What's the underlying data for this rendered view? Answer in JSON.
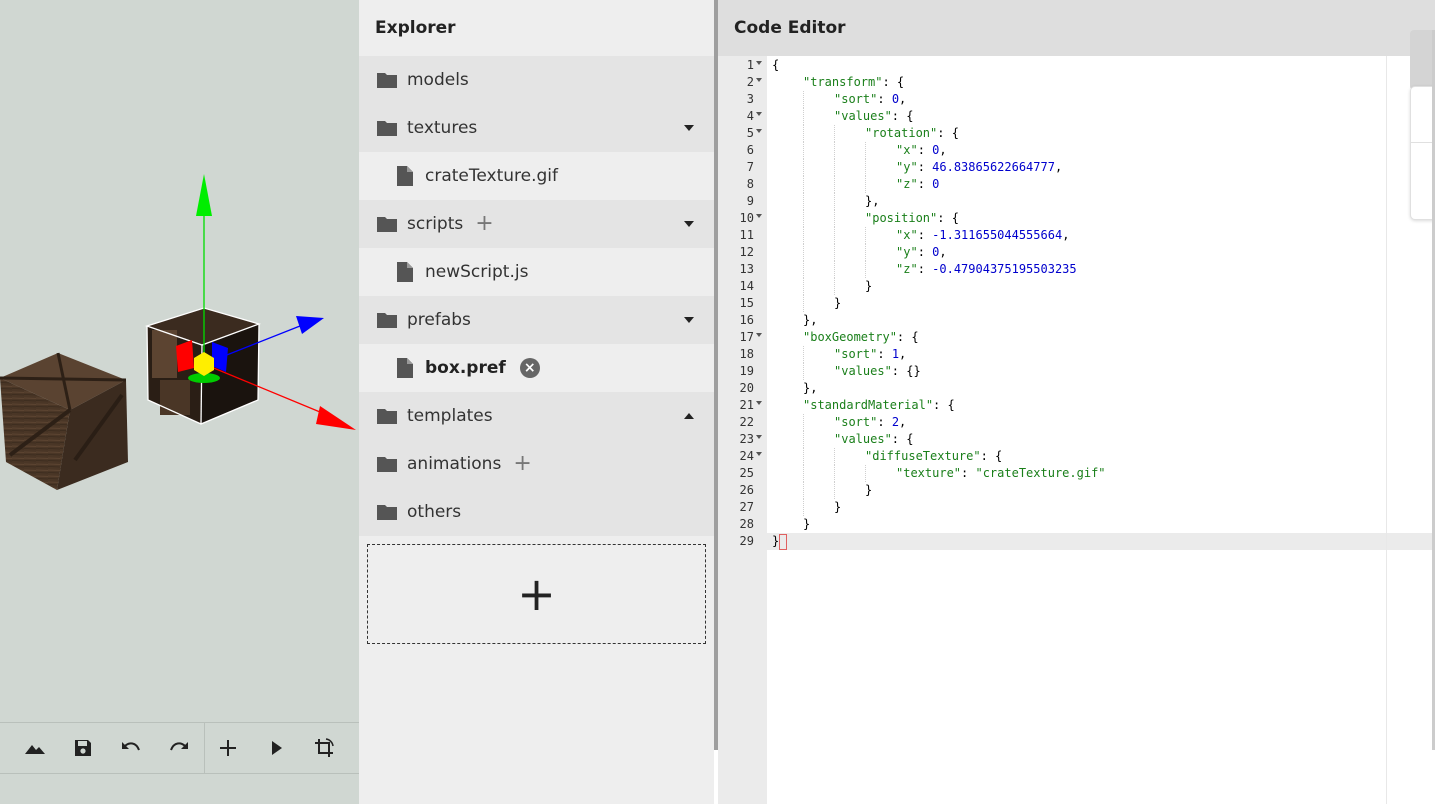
{
  "viewport": {
    "toolbar": {
      "terrain_icon": "terrain-icon",
      "save_icon": "save-icon",
      "undo_icon": "undo-icon",
      "redo_icon": "redo-icon",
      "add_icon": "add-icon",
      "play_icon": "play-icon",
      "transform_icon": "transform-icon"
    },
    "gizmo_colors": {
      "x": "#ff0000",
      "y": "#00cc00",
      "z": "#0000ff",
      "center": "#ffee00"
    }
  },
  "explorer": {
    "title": "Explorer",
    "items": [
      {
        "type": "folder",
        "label": "models",
        "plus": false,
        "caret": ""
      },
      {
        "type": "folder",
        "label": "textures",
        "plus": false,
        "caret": "down"
      },
      {
        "type": "file",
        "label": "crateTexture.gif",
        "bold": false,
        "close": false
      },
      {
        "type": "folder",
        "label": "scripts",
        "plus": true,
        "caret": "down"
      },
      {
        "type": "file",
        "label": "newScript.js",
        "bold": false,
        "close": false
      },
      {
        "type": "folder",
        "label": "prefabs",
        "plus": false,
        "caret": "down"
      },
      {
        "type": "file",
        "label": "box.pref",
        "bold": true,
        "close": true
      },
      {
        "type": "folder",
        "label": "templates",
        "plus": false,
        "caret": "up"
      },
      {
        "type": "folder",
        "label": "animations",
        "plus": true,
        "caret": ""
      },
      {
        "type": "folder",
        "label": "others",
        "plus": false,
        "caret": ""
      }
    ],
    "drop_zone_label": "+"
  },
  "editor": {
    "title": "Code Editor",
    "active_line": 29,
    "lines": [
      {
        "n": 1,
        "fold": true,
        "indent": 0,
        "tokens": [
          [
            "p",
            "{"
          ]
        ]
      },
      {
        "n": 2,
        "fold": true,
        "indent": 1,
        "tokens": [
          [
            "s",
            "\"transform\""
          ],
          [
            "p",
            ": {"
          ]
        ]
      },
      {
        "n": 3,
        "fold": false,
        "indent": 2,
        "tokens": [
          [
            "s",
            "\"sort\""
          ],
          [
            "p",
            ": "
          ],
          [
            "n",
            "0"
          ],
          [
            "p",
            ","
          ]
        ]
      },
      {
        "n": 4,
        "fold": true,
        "indent": 2,
        "tokens": [
          [
            "s",
            "\"values\""
          ],
          [
            "p",
            ": {"
          ]
        ]
      },
      {
        "n": 5,
        "fold": true,
        "indent": 3,
        "tokens": [
          [
            "s",
            "\"rotation\""
          ],
          [
            "p",
            ": {"
          ]
        ]
      },
      {
        "n": 6,
        "fold": false,
        "indent": 4,
        "tokens": [
          [
            "s",
            "\"x\""
          ],
          [
            "p",
            ": "
          ],
          [
            "n",
            "0"
          ],
          [
            "p",
            ","
          ]
        ]
      },
      {
        "n": 7,
        "fold": false,
        "indent": 4,
        "tokens": [
          [
            "s",
            "\"y\""
          ],
          [
            "p",
            ": "
          ],
          [
            "n",
            "46.83865622664777"
          ],
          [
            "p",
            ","
          ]
        ]
      },
      {
        "n": 8,
        "fold": false,
        "indent": 4,
        "tokens": [
          [
            "s",
            "\"z\""
          ],
          [
            "p",
            ": "
          ],
          [
            "n",
            "0"
          ]
        ]
      },
      {
        "n": 9,
        "fold": false,
        "indent": 3,
        "tokens": [
          [
            "p",
            "},"
          ]
        ]
      },
      {
        "n": 10,
        "fold": true,
        "indent": 3,
        "tokens": [
          [
            "s",
            "\"position\""
          ],
          [
            "p",
            ": {"
          ]
        ]
      },
      {
        "n": 11,
        "fold": false,
        "indent": 4,
        "tokens": [
          [
            "s",
            "\"x\""
          ],
          [
            "p",
            ": "
          ],
          [
            "n",
            "-1.311655044555664"
          ],
          [
            "p",
            ","
          ]
        ]
      },
      {
        "n": 12,
        "fold": false,
        "indent": 4,
        "tokens": [
          [
            "s",
            "\"y\""
          ],
          [
            "p",
            ": "
          ],
          [
            "n",
            "0"
          ],
          [
            "p",
            ","
          ]
        ]
      },
      {
        "n": 13,
        "fold": false,
        "indent": 4,
        "tokens": [
          [
            "s",
            "\"z\""
          ],
          [
            "p",
            ": "
          ],
          [
            "n",
            "-0.47904375195503235"
          ]
        ]
      },
      {
        "n": 14,
        "fold": false,
        "indent": 3,
        "tokens": [
          [
            "p",
            "}"
          ]
        ]
      },
      {
        "n": 15,
        "fold": false,
        "indent": 2,
        "tokens": [
          [
            "p",
            "}"
          ]
        ]
      },
      {
        "n": 16,
        "fold": false,
        "indent": 1,
        "tokens": [
          [
            "p",
            "},"
          ]
        ]
      },
      {
        "n": 17,
        "fold": true,
        "indent": 1,
        "tokens": [
          [
            "s",
            "\"boxGeometry\""
          ],
          [
            "p",
            ": {"
          ]
        ]
      },
      {
        "n": 18,
        "fold": false,
        "indent": 2,
        "tokens": [
          [
            "s",
            "\"sort\""
          ],
          [
            "p",
            ": "
          ],
          [
            "n",
            "1"
          ],
          [
            "p",
            ","
          ]
        ]
      },
      {
        "n": 19,
        "fold": false,
        "indent": 2,
        "tokens": [
          [
            "s",
            "\"values\""
          ],
          [
            "p",
            ": {}"
          ]
        ]
      },
      {
        "n": 20,
        "fold": false,
        "indent": 1,
        "tokens": [
          [
            "p",
            "},"
          ]
        ]
      },
      {
        "n": 21,
        "fold": true,
        "indent": 1,
        "tokens": [
          [
            "s",
            "\"standardMaterial\""
          ],
          [
            "p",
            ": {"
          ]
        ]
      },
      {
        "n": 22,
        "fold": false,
        "indent": 2,
        "tokens": [
          [
            "s",
            "\"sort\""
          ],
          [
            "p",
            ": "
          ],
          [
            "n",
            "2"
          ],
          [
            "p",
            ","
          ]
        ]
      },
      {
        "n": 23,
        "fold": true,
        "indent": 2,
        "tokens": [
          [
            "s",
            "\"values\""
          ],
          [
            "p",
            ": {"
          ]
        ]
      },
      {
        "n": 24,
        "fold": true,
        "indent": 3,
        "tokens": [
          [
            "s",
            "\"diffuseTexture\""
          ],
          [
            "p",
            ": {"
          ]
        ]
      },
      {
        "n": 25,
        "fold": false,
        "indent": 4,
        "tokens": [
          [
            "s",
            "\"texture\""
          ],
          [
            "p",
            ": "
          ],
          [
            "s",
            "\"crateTexture.gif\""
          ]
        ]
      },
      {
        "n": 26,
        "fold": false,
        "indent": 3,
        "tokens": [
          [
            "p",
            "}"
          ]
        ]
      },
      {
        "n": 27,
        "fold": false,
        "indent": 2,
        "tokens": [
          [
            "p",
            "}"
          ]
        ]
      },
      {
        "n": 28,
        "fold": false,
        "indent": 1,
        "tokens": [
          [
            "p",
            "}"
          ]
        ]
      },
      {
        "n": 29,
        "fold": false,
        "indent": 0,
        "tokens": [
          [
            "p",
            "}"
          ]
        ]
      }
    ]
  }
}
